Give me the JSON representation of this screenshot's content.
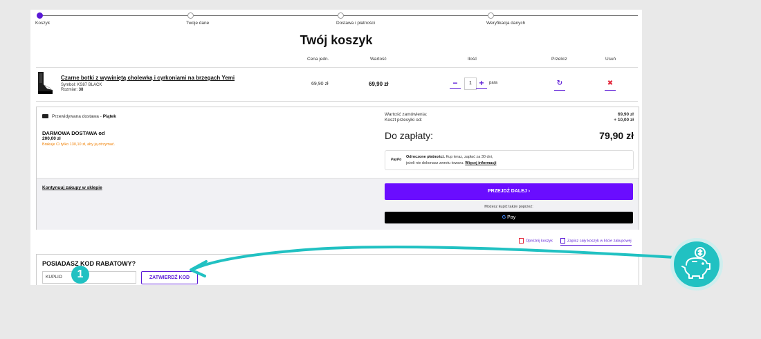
{
  "steps": [
    {
      "label": "Koszyk",
      "active": true
    },
    {
      "label": "Twoje dane",
      "active": false
    },
    {
      "label": "Dostawa i płatności",
      "active": false
    },
    {
      "label": "Weryfikacja danych",
      "active": false
    }
  ],
  "page_title": "Twój koszyk",
  "table_headers": {
    "unit_price": "Cena jedn.",
    "value": "Wartość",
    "quantity": "Ilość",
    "recalculate": "Przelicz",
    "remove": "Usuń"
  },
  "product": {
    "name": "Czarne botki z wywiniętą cholewką i cyrkoniami na brzegach Yemi",
    "symbol": "Symbol: KS87 BLACK",
    "size_label": "Rozmiar:",
    "size": "38",
    "unit_price": "69,90 zł",
    "value": "69,90 zł",
    "quantity": "1",
    "unit": "para",
    "minus": "−",
    "plus": "+",
    "recalc_icon": "↻",
    "remove_icon": "✖"
  },
  "delivery": {
    "label": "Przewidywana dostawa -",
    "day": "Piątek",
    "free_title": "DARMOWA DOSTAWA od",
    "free_amount": "200,00 zł",
    "free_note": "Brakuje Ci tylko 130,10 zł, aby ją otrzymać."
  },
  "summary": {
    "order_value_label": "Wartość zamówienia:",
    "order_value": "69,90 zł",
    "shipping_label": "Koszt przesyłki od:",
    "shipping": "+ 10,00 zł",
    "to_pay_label": "Do zapłaty:",
    "to_pay": "79,90 zł"
  },
  "paypo": {
    "logo": "PayPo",
    "bold": "Odroczone płatności.",
    "text1": "Kup teraz, zapłać za 30 dni,",
    "text2": "jeżeli nie dokonasz zwrotu towaru.",
    "link": "Więcej informacji"
  },
  "actions": {
    "continue": "Kontynuuj zakupy w sklepie",
    "next": "PRZEJDŹ DALEJ ›",
    "alt_buy": "Możesz kupić także poprzez:",
    "gpay": "Pay",
    "gpay_g": "G",
    "empty_cart": "Opróżnij koszyk",
    "save_cart": "Zapisz cały koszyk w liście zakupowej"
  },
  "discount": {
    "title": "POSIADASZ KOD RABATOWY?",
    "code_value": "KUPLIO",
    "submit": "ZATWIERDŹ KOD"
  },
  "annotation": {
    "badge": "1",
    "accent": "#21c1c2"
  },
  "colors": {
    "primary": "#6a0dff",
    "accent_link": "#5b1ad6",
    "danger": "#e3263a",
    "warning": "#f07f00"
  }
}
